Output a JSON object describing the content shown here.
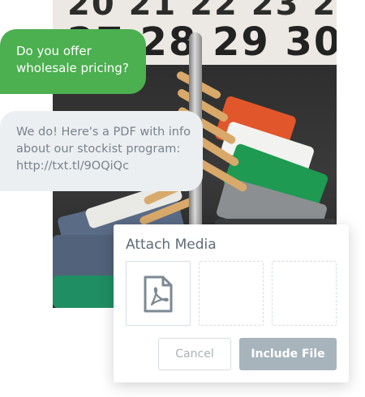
{
  "background": {
    "calendar_numbers_top": "20 21 22 23 2",
    "calendar_numbers_bottom": "27 28 29 30 3"
  },
  "messages": [
    {
      "direction": "outgoing",
      "text": "Do you offer wholesale pricing?"
    },
    {
      "direction": "incoming",
      "text": "We do! Here's a PDF with info about our stockist program: http://txt.tl/9OQiQc"
    }
  ],
  "attach_media": {
    "title": "Attach Media",
    "slots": [
      {
        "icon": "pdf-file-icon",
        "filled": true
      },
      {
        "filled": false
      },
      {
        "filled": false
      }
    ],
    "cancel_label": "Cancel",
    "include_label": "Include File"
  },
  "colors": {
    "outgoing_bubble": "#4caf50",
    "incoming_bubble": "#eceff2",
    "incoming_text": "#78828c",
    "include_button": "#a8b4bc",
    "icon": "#7d8a94"
  }
}
